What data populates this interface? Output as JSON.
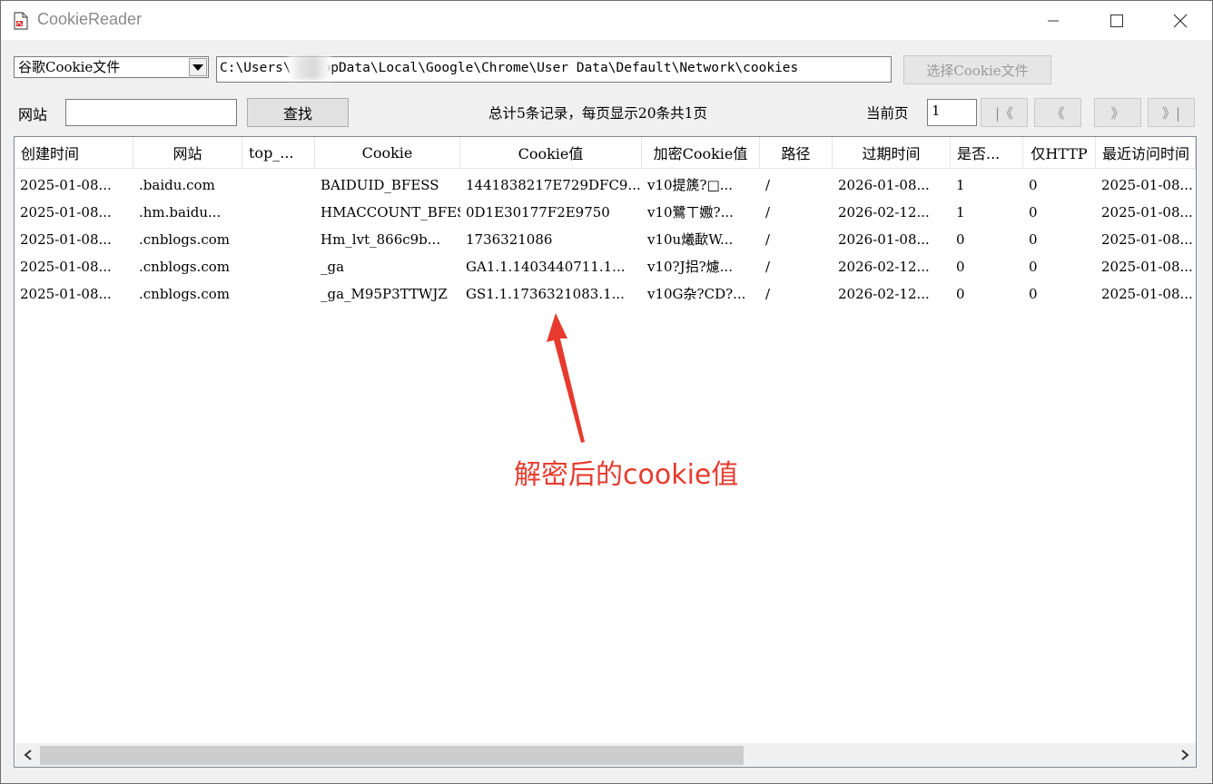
{
  "window": {
    "title": "CookieReader",
    "controls": [
      "minimize-icon",
      "maximize-icon",
      "close-icon"
    ]
  },
  "toolbar": {
    "browser_select": "谷歌Cookie文件",
    "path": "C:\\Users\\    .\\AppData\\Local\\Google\\Chrome\\User Data\\Default\\Network\\cookies",
    "select_file_label": "选择Cookie文件",
    "site_label": "网站",
    "site_value": "",
    "find_label": "查找",
    "summary": "总计5条记录，每页显示20条共1页",
    "current_page_label": "当前页",
    "current_page_value": "1",
    "first_label": "|《",
    "prev_label": "《",
    "next_label": "》",
    "last_label": "》|"
  },
  "table": {
    "columns": [
      "创建时间",
      "网站",
      "top_...",
      "Cookie",
      "Cookie值",
      "加密Cookie值",
      "路径",
      "过期时间",
      "是否...",
      "仅HTTP",
      "最近访问时间"
    ],
    "rows": [
      [
        "2025-01-08...",
        ".baidu.com",
        "",
        "BAIDUID_BFESS",
        "1441838217E729DFC9...",
        "v10提篪?□...",
        "/",
        "2026-01-08...",
        "1",
        "0",
        "2025-01-08..."
      ],
      [
        "2025-01-08...",
        ".hm.baidu...",
        "",
        "HMACCOUNT_BFESS",
        "0D1E30177F2E9750",
        "v10鷺ㄒ嫐?...",
        "/",
        "2026-02-12...",
        "1",
        "0",
        "2025-01-08..."
      ],
      [
        "2025-01-08...",
        ".cnblogs.com",
        "",
        "Hm_lvt_866c9b...",
        "1736321086",
        "v10u爔歃W...",
        "/",
        "2026-01-08...",
        "0",
        "0",
        "2025-01-08..."
      ],
      [
        "2025-01-08...",
        ".cnblogs.com",
        "",
        "_ga",
        "GA1.1.1403440711.1...",
        "v10?J捛?爈...",
        "/",
        "2026-02-12...",
        "0",
        "0",
        "2025-01-08..."
      ],
      [
        "2025-01-08...",
        ".cnblogs.com",
        "",
        "_ga_M95P3TTWJZ",
        "GS1.1.1736321083.1...",
        "v10G杂?CD?...",
        "/",
        "2026-02-12...",
        "0",
        "0",
        "2025-01-08..."
      ]
    ]
  },
  "annotation": {
    "text": "解密后的cookie值",
    "color": "#e63b2e"
  }
}
